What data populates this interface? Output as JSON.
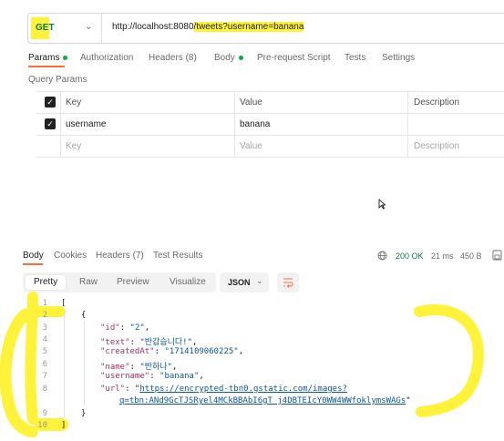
{
  "request": {
    "method": "GET",
    "url_base": "http://localhost:8080",
    "url_path": "/tweets?username=banana"
  },
  "request_tabs": [
    {
      "label": "Params",
      "dot": true
    },
    {
      "label": "Authorization"
    },
    {
      "label": "Headers (8)"
    },
    {
      "label": "Body",
      "dot": true
    },
    {
      "label": "Pre-request Script"
    },
    {
      "label": "Tests"
    },
    {
      "label": "Settings"
    }
  ],
  "query_params": {
    "title": "Query Params",
    "headers": {
      "key": "Key",
      "value": "Value",
      "description": "Description"
    },
    "rows": [
      {
        "key": "username",
        "value": "banana",
        "checked": true
      }
    ],
    "placeholder": {
      "key": "Key",
      "value": "Value",
      "description": "Description"
    }
  },
  "response": {
    "tabs": [
      "Body",
      "Cookies",
      "Headers (7)",
      "Test Results"
    ],
    "status": "200 OK",
    "time": "21 ms",
    "size": "450 B",
    "view_modes": [
      "Pretty",
      "Raw",
      "Preview",
      "Visualize"
    ],
    "format": "JSON",
    "lines": [
      "1",
      "2",
      "3",
      "4",
      "5",
      "6",
      "7",
      "8",
      "9",
      "10"
    ],
    "json": {
      "open_array": "[",
      "open_obj": "{",
      "id_key": "\"id\"",
      "id_val": "\"2\"",
      "text_key": "\"text\"",
      "text_val": "\"반갑습니다!\"",
      "createdAt_key": "\"createdAt\"",
      "createdAt_val": "\"1714109060225\"",
      "name_key": "\"name\"",
      "name_val": "\"반하나\"",
      "username_key": "\"username\"",
      "username_val": "\"banana\"",
      "url_key": "\"url\"",
      "url_val_1": "https://encrypted-tbn0.gstatic.com/images?",
      "url_val_2": "q=tbn:ANd9GcTJSRyel4MCkBBAbI6gT_j4DBTEIcY0WW4WWfoklymsWAGs",
      "close_obj": "}",
      "close_array": "]"
    }
  },
  "colors": {
    "highlight": "#fff23a",
    "accent": "#ff6c37",
    "success": "#0b7a41"
  }
}
